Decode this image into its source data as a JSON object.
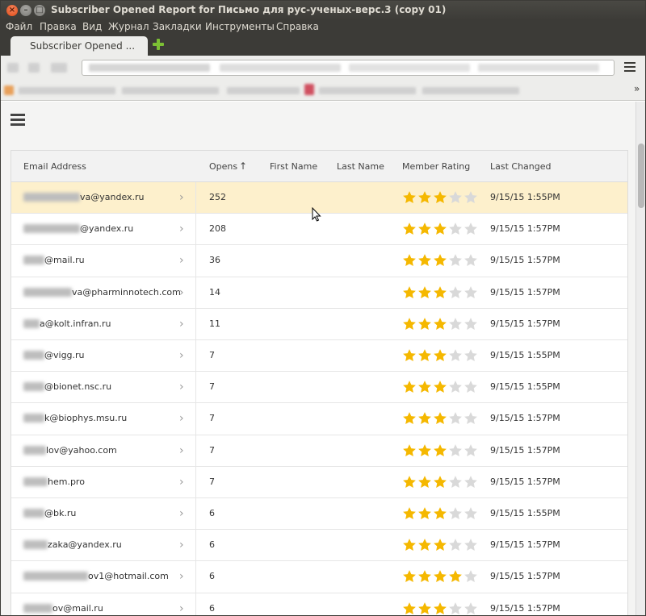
{
  "window": {
    "title": "Subscriber Opened Report for Письмо для рус-ученых-верс.3 (copy 01)"
  },
  "menu": [
    "Файл",
    "Правка",
    "Вид",
    "Журнал",
    "Закладки",
    "Инструменты",
    "Справка"
  ],
  "tabs": [
    {
      "label": "Subscriber Opened ..."
    }
  ],
  "table": {
    "headers": {
      "email": "Email Address",
      "opens": "Opens",
      "first_name": "First Name",
      "last_name": "Last Name",
      "rating": "Member Rating",
      "last_changed": "Last Changed"
    },
    "rows": [
      {
        "email_visible": "va@yandex.ru",
        "opens": "252",
        "rating": 3,
        "last_changed": "9/15/15 1:55PM"
      },
      {
        "email_visible": "@yandex.ru",
        "opens": "208",
        "rating": 3,
        "last_changed": "9/15/15 1:57PM"
      },
      {
        "email_visible": "@mail.ru",
        "opens": "36",
        "rating": 3,
        "last_changed": "9/15/15 1:57PM"
      },
      {
        "email_visible": "va@pharminnotech.com",
        "opens": "14",
        "rating": 3,
        "last_changed": "9/15/15 1:57PM"
      },
      {
        "email_visible": "a@kolt.infran.ru",
        "opens": "11",
        "rating": 3,
        "last_changed": "9/15/15 1:57PM"
      },
      {
        "email_visible": "@vigg.ru",
        "opens": "7",
        "rating": 3,
        "last_changed": "9/15/15 1:55PM"
      },
      {
        "email_visible": "@bionet.nsc.ru",
        "opens": "7",
        "rating": 3,
        "last_changed": "9/15/15 1:55PM"
      },
      {
        "email_visible": "k@biophys.msu.ru",
        "opens": "7",
        "rating": 3,
        "last_changed": "9/15/15 1:57PM"
      },
      {
        "email_visible": "lov@yahoo.com",
        "opens": "7",
        "rating": 3,
        "last_changed": "9/15/15 1:57PM"
      },
      {
        "email_visible": "hem.pro",
        "opens": "7",
        "rating": 3,
        "last_changed": "9/15/15 1:57PM"
      },
      {
        "email_visible": "@bk.ru",
        "opens": "6",
        "rating": 3,
        "last_changed": "9/15/15 1:55PM"
      },
      {
        "email_visible": "zaka@yandex.ru",
        "opens": "6",
        "rating": 3,
        "last_changed": "9/15/15 1:57PM"
      },
      {
        "email_visible": "ov1@hotmail.com",
        "opens": "6",
        "rating": 4,
        "last_changed": "9/15/15 1:57PM"
      },
      {
        "email_visible": "ov@mail.ru",
        "opens": "6",
        "rating": 3,
        "last_changed": "9/15/15 1:57PM"
      }
    ]
  },
  "colors": {
    "star_filled": "#f5b800",
    "star_empty": "#d9d9d9",
    "selected_row": "#fdf0cc"
  },
  "icons": {
    "menu": "hamburger-icon",
    "chevron": "chevron-right-icon",
    "sort": "sort-up-arrow-icon",
    "new_tab": "plus-icon"
  }
}
